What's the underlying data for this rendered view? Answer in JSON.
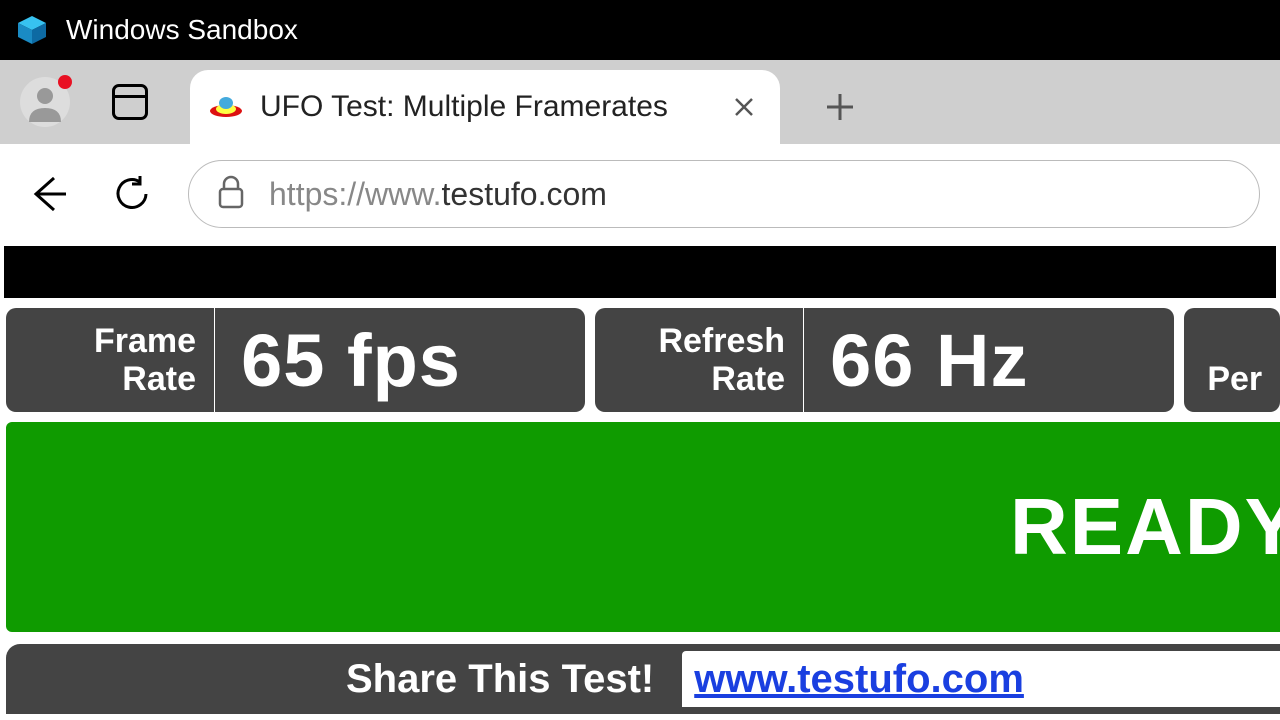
{
  "window": {
    "title": "Windows Sandbox"
  },
  "browser": {
    "tab_title": "UFO Test: Multiple Framerates",
    "url_scheme": "https://www.",
    "url_domain": "testufo.com"
  },
  "stats": [
    {
      "label_line1": "Frame",
      "label_line2": "Rate",
      "value": "65 fps"
    },
    {
      "label_line1": "Refresh",
      "label_line2": "Rate",
      "value": "66 Hz"
    }
  ],
  "stats_partial_label": "Per ",
  "ready_text": "READY",
  "share": {
    "label": "Share This Test!",
    "link": "www.testufo.com"
  },
  "colors": {
    "ready_green": "#0f9b00",
    "panel_gray": "#444"
  }
}
